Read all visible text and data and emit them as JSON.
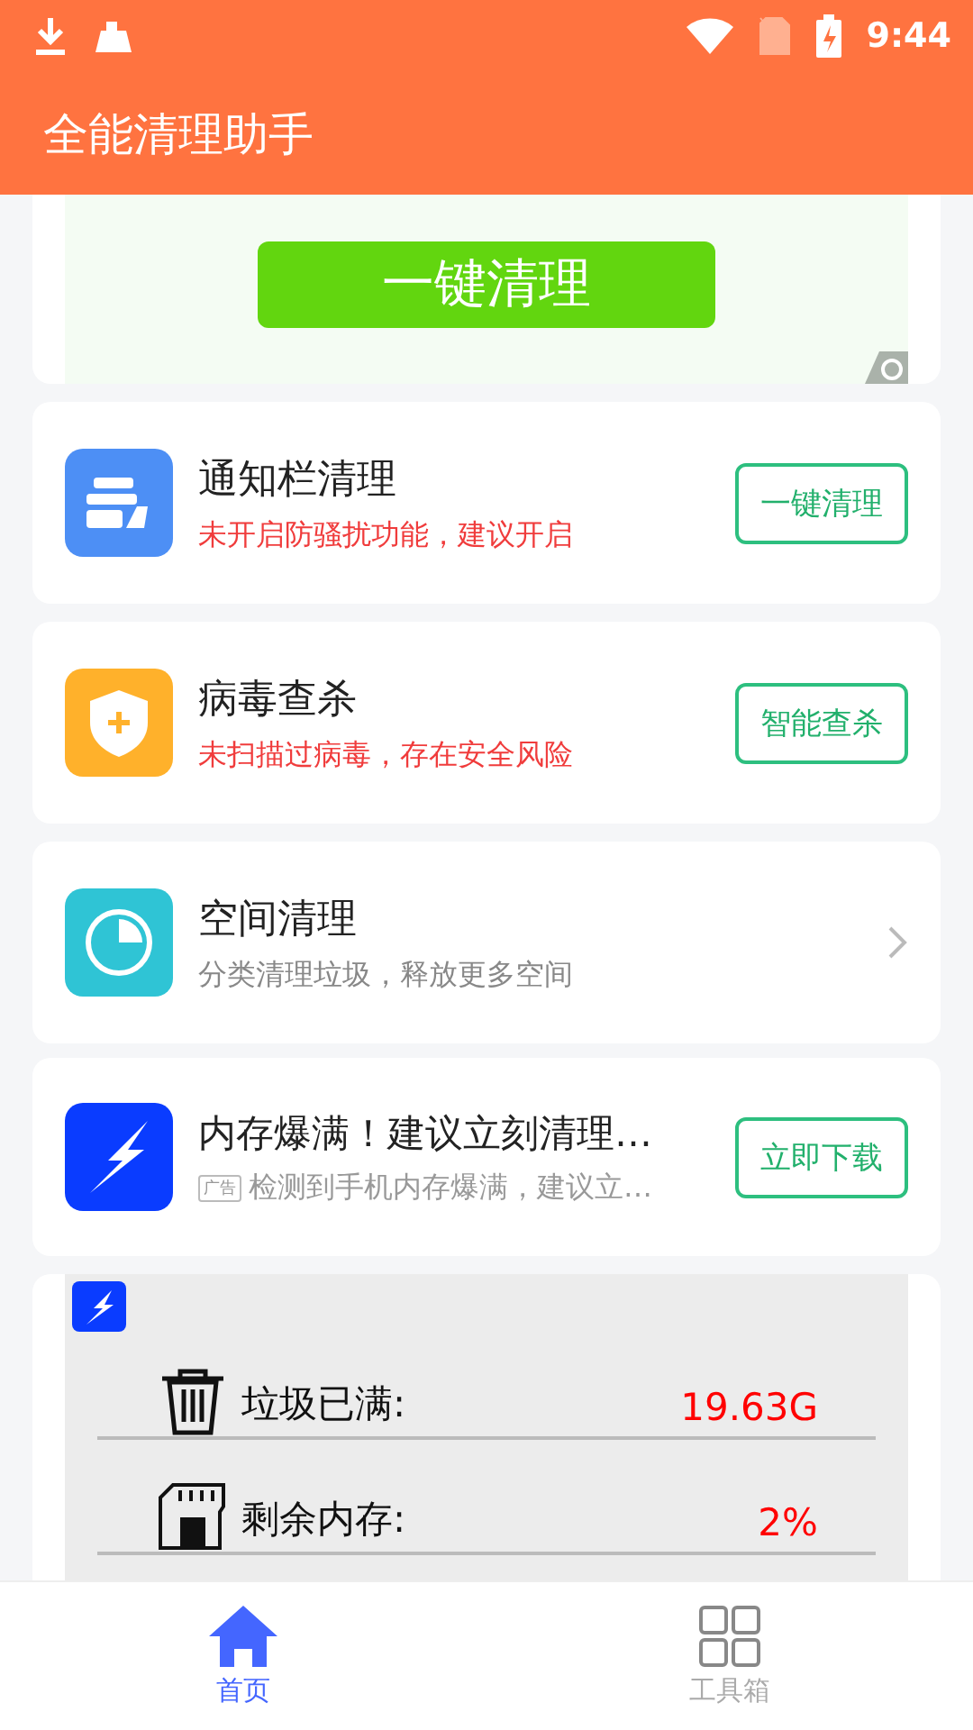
{
  "status_bar": {
    "time": "9:44"
  },
  "app_bar": {
    "title": "全能清理助手"
  },
  "banner": {
    "button": "一键清理"
  },
  "features": [
    {
      "kind": "button",
      "title": "通知栏清理",
      "subtitle": "未开启防骚扰功能，建议开启",
      "warning": true,
      "action": "一键清理"
    },
    {
      "kind": "button",
      "title": "病毒查杀",
      "subtitle": "未扫描过病毒，存在安全风险",
      "warning": true,
      "action": "智能查杀"
    },
    {
      "kind": "chevron",
      "title": "空间清理",
      "subtitle": "分类清理垃圾，释放更多空间",
      "warning": false
    }
  ],
  "ad": {
    "title": "内存爆满！建议立刻清理…",
    "tag": "广告",
    "description": "检测到手机内存爆满，建议立…",
    "action": "立即下载"
  },
  "stats": [
    {
      "kind": "trash",
      "label": "垃圾已满:",
      "value": "19.63G"
    },
    {
      "kind": "sdcard",
      "label": "剩余内存:",
      "value": "2%"
    }
  ],
  "bottom_nav": [
    {
      "label": "首页",
      "selected": true
    },
    {
      "label": "工具箱",
      "selected": false
    }
  ]
}
